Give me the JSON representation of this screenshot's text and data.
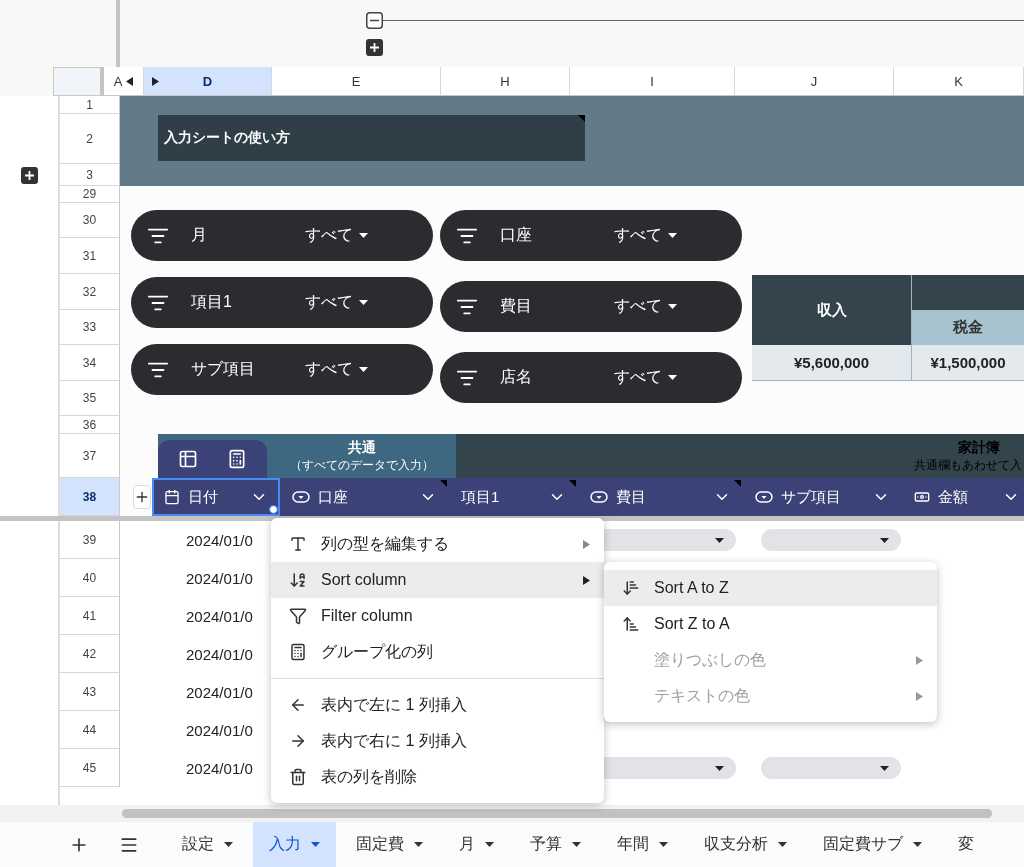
{
  "column_headers": [
    {
      "label": "A",
      "selected": false
    },
    {
      "label": "D",
      "selected": true
    },
    {
      "label": "E",
      "selected": false
    },
    {
      "label": "H",
      "selected": false
    },
    {
      "label": "I",
      "selected": false
    },
    {
      "label": "J",
      "selected": false
    },
    {
      "label": "K",
      "selected": false
    }
  ],
  "row_numbers_top": [
    {
      "label": "1",
      "selected": false
    },
    {
      "label": "2",
      "selected": false
    },
    {
      "label": "3",
      "selected": false
    },
    {
      "label": "29",
      "selected": false
    },
    {
      "label": "30",
      "selected": false
    },
    {
      "label": "31",
      "selected": false
    },
    {
      "label": "32",
      "selected": false
    },
    {
      "label": "33",
      "selected": false
    },
    {
      "label": "34",
      "selected": false
    },
    {
      "label": "35",
      "selected": false
    },
    {
      "label": "36",
      "selected": false
    },
    {
      "label": "37",
      "selected": false
    },
    {
      "label": "38",
      "selected": true
    }
  ],
  "banner": {
    "title": "入力シートの使い方",
    "note": true
  },
  "filters": {
    "left": [
      {
        "label": "月",
        "value": "すべて"
      },
      {
        "label": "項目1",
        "value": "すべて"
      },
      {
        "label": "サブ項目",
        "value": "すべて"
      }
    ],
    "right": [
      {
        "label": "口座",
        "value": "すべて"
      },
      {
        "label": "費目",
        "value": "すべて"
      },
      {
        "label": "店名",
        "value": "すべて"
      }
    ]
  },
  "summary": {
    "columns": [
      {
        "kind": "single",
        "header": "収入",
        "value": "¥5,600,000"
      },
      {
        "kind": "grouped",
        "header": "税金",
        "value": "¥1,500,000"
      }
    ]
  },
  "table": {
    "groups": [
      {
        "title": "共通",
        "subtitle": "（すべてのデータで入力）"
      },
      {
        "title": "家計簿",
        "subtitle": "共通欄もあわせて入"
      }
    ],
    "columns": [
      {
        "label": "日付",
        "kind": "date",
        "selected": true,
        "note": false
      },
      {
        "label": "口座",
        "kind": "dropdown",
        "selected": false,
        "note": true
      },
      {
        "label": "項目1",
        "kind": "text",
        "selected": false,
        "note": true
      },
      {
        "label": "費目",
        "kind": "dropdown",
        "selected": false,
        "note": true
      },
      {
        "label": "サブ項目",
        "kind": "dropdown",
        "selected": false,
        "note": false
      },
      {
        "label": "金額",
        "kind": "money",
        "selected": false,
        "note": false
      }
    ],
    "rows": [
      {
        "number": "39",
        "date": "2024/01/0",
        "has_dropdowns": true
      },
      {
        "number": "40",
        "date": "2024/01/0"
      },
      {
        "number": "41",
        "date": "2024/01/0"
      },
      {
        "number": "42",
        "date": "2024/01/0"
      },
      {
        "number": "43",
        "date": "2024/01/0"
      },
      {
        "number": "44",
        "date": "2024/01/0",
        "has_dropdowns": false
      },
      {
        "number": "45",
        "date": "2024/01/0",
        "has_dropdowns": true
      }
    ]
  },
  "context_menu": {
    "items": [
      {
        "kind": "type",
        "label": "列の型を編集する",
        "submenu": true,
        "selected": false
      },
      {
        "kind": "sort",
        "label": "Sort column",
        "submenu": true,
        "selected": true
      },
      {
        "kind": "filter",
        "label": "Filter column",
        "submenu": false,
        "selected": false
      },
      {
        "kind": "group",
        "label": "グループ化の列",
        "submenu": false,
        "selected": false
      },
      {
        "kind": "divider"
      },
      {
        "kind": "insert-left",
        "label": "表内で左に 1 列挿入",
        "submenu": false,
        "selected": false
      },
      {
        "kind": "insert-right",
        "label": "表内で右に 1 列挿入",
        "submenu": false,
        "selected": false
      },
      {
        "kind": "delete",
        "label": "表の列を削除",
        "submenu": false,
        "selected": false
      }
    ]
  },
  "submenu": {
    "items": [
      {
        "kind": "sort-asc",
        "label": "Sort A to Z",
        "selected": true,
        "disabled": false,
        "submenu": false
      },
      {
        "kind": "sort-desc",
        "label": "Sort Z to A",
        "selected": false,
        "disabled": false,
        "submenu": false
      },
      {
        "kind": "plain",
        "label": "塗りつぶしの色",
        "selected": false,
        "disabled": true,
        "submenu": true
      },
      {
        "kind": "plain",
        "label": "テキストの色",
        "selected": false,
        "disabled": true,
        "submenu": true
      }
    ]
  },
  "sheet_tabs": [
    {
      "label": "設定",
      "selected": false
    },
    {
      "label": "入力",
      "selected": true
    },
    {
      "label": "固定費",
      "selected": false
    },
    {
      "label": "月",
      "selected": false
    },
    {
      "label": "予算",
      "selected": false
    },
    {
      "label": "年間",
      "selected": false
    },
    {
      "label": "収支分析",
      "selected": false
    },
    {
      "label": "固定費サブ",
      "selected": false
    },
    {
      "label": "変",
      "selected": false
    }
  ]
}
